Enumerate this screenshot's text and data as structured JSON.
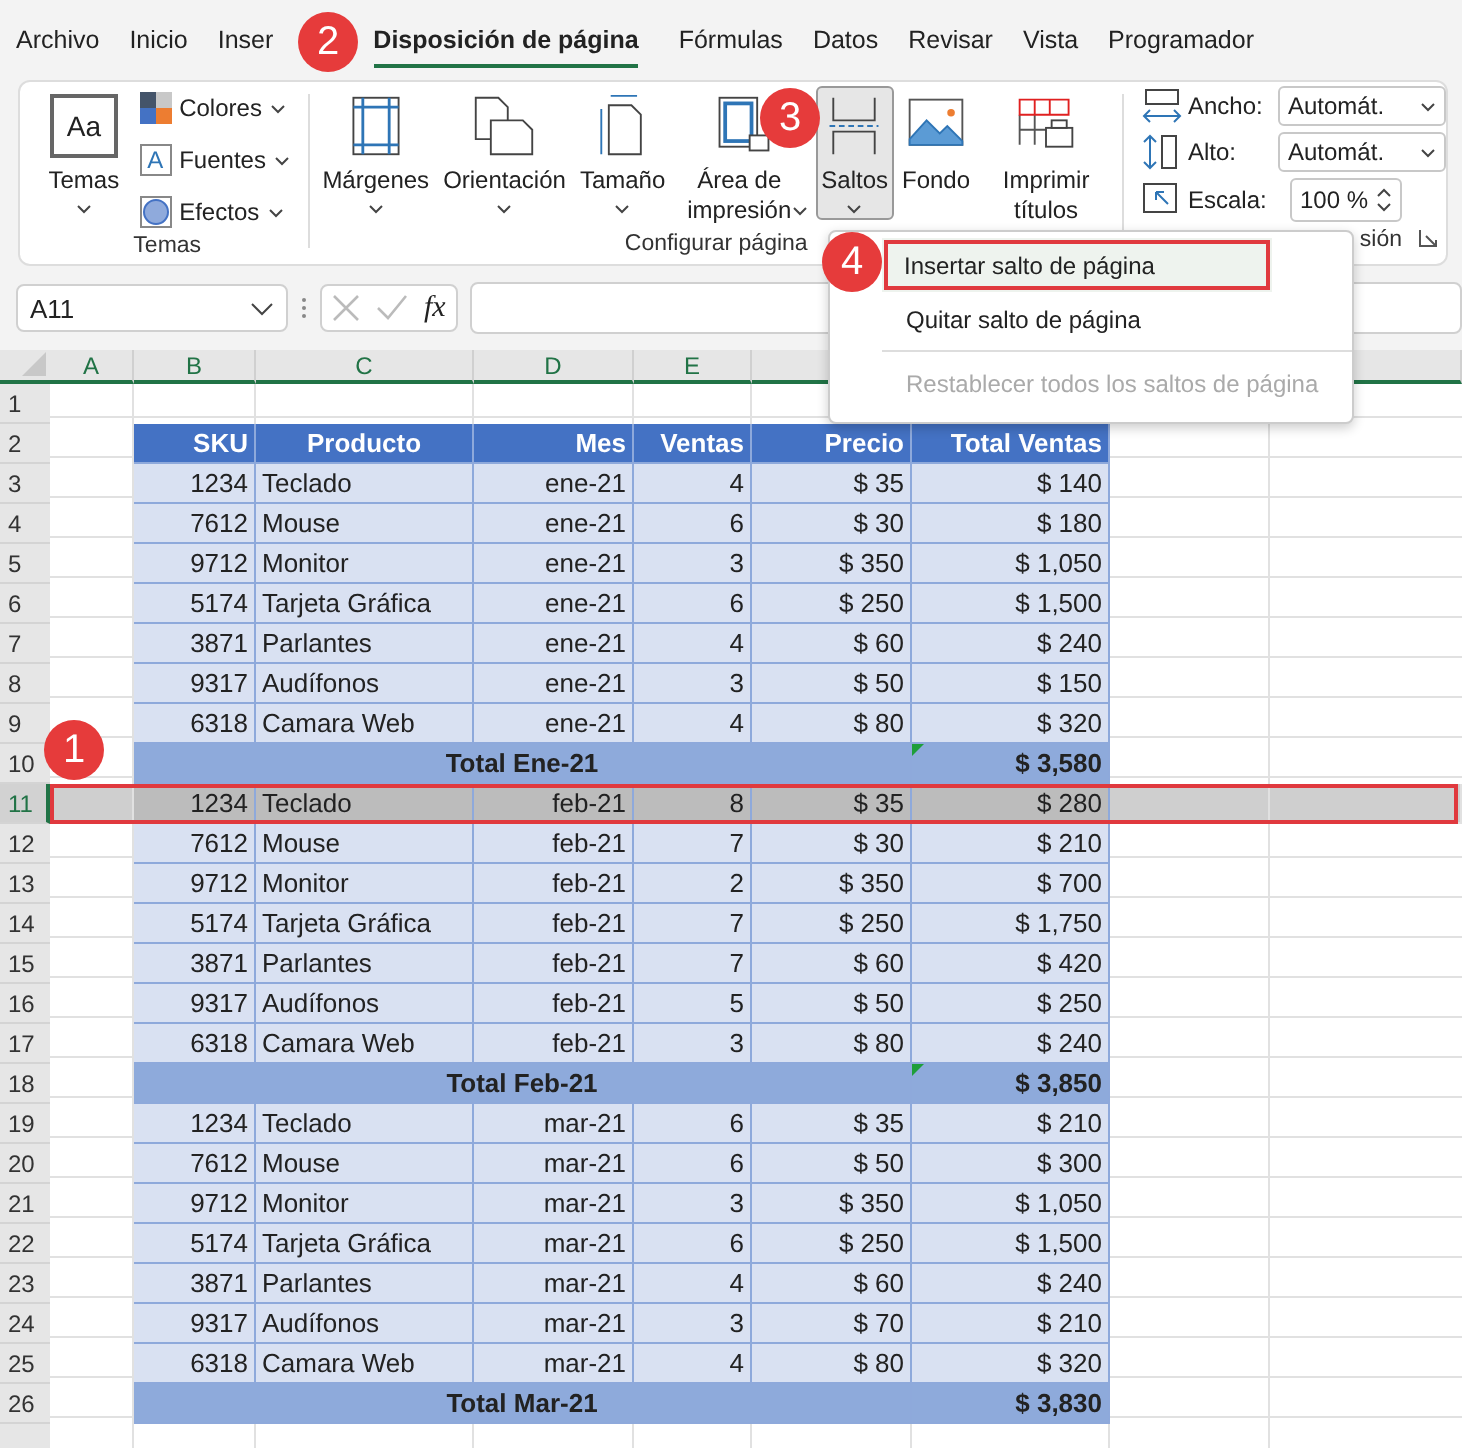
{
  "tabs": [
    {
      "label": "Archivo",
      "selected": false
    },
    {
      "label": "Inicio",
      "selected": false
    },
    {
      "label": "Inser",
      "selected": false
    },
    {
      "label": "Disposición de página",
      "selected": true
    },
    {
      "label": "Fórmulas",
      "selected": false
    },
    {
      "label": "Datos",
      "selected": false
    },
    {
      "label": "Revisar",
      "selected": false
    },
    {
      "label": "Vista",
      "selected": false
    },
    {
      "label": "Programador",
      "selected": false
    }
  ],
  "ribbon": {
    "themes_group": {
      "label": "Temas",
      "big_button": "Temas",
      "icon_text": "Aa",
      "font_icon_text": "A",
      "small_buttons": [
        "Colores",
        "Fuentes",
        "Efectos"
      ]
    },
    "page_setup_group": {
      "label": "Configurar página",
      "buttons": [
        {
          "kind": "margins",
          "label": "Márgenes",
          "pressed": false
        },
        {
          "kind": "orientation",
          "label": "Orientación",
          "pressed": false
        },
        {
          "kind": "size",
          "label": "Tamaño",
          "pressed": false
        },
        {
          "kind": "area",
          "label": "Área de impresión",
          "pressed": false
        },
        {
          "kind": "breaks",
          "label": "Saltos",
          "pressed": true
        },
        {
          "kind": "background",
          "label": "Fondo",
          "pressed": false
        },
        {
          "kind": "titles",
          "label": "Imprimir títulos",
          "pressed": false
        }
      ]
    },
    "scale_group": {
      "label": "sión",
      "width_label": "Ancho:",
      "width_value": "Automát.",
      "height_label": "Alto:",
      "height_value": "Automát.",
      "scale_label": "Escala:",
      "scale_value": "100 %"
    }
  },
  "breaks_menu": [
    {
      "label": "Insertar salto de página",
      "selected": true,
      "disabled": false
    },
    {
      "label": "Quitar salto de página",
      "selected": false,
      "disabled": false
    },
    {
      "label": "Restablecer todos los saltos de página",
      "selected": false,
      "disabled": true
    }
  ],
  "formula_bar": {
    "name_box": "A11",
    "fx": "fx"
  },
  "columns": [
    "A",
    "B",
    "C",
    "D",
    "E"
  ],
  "rows": [
    {
      "number": "1",
      "kind": "empty",
      "selected": false
    },
    {
      "number": "2",
      "kind": "header",
      "selected": false,
      "cells": [
        "SKU",
        "Producto",
        "Mes",
        "Ventas",
        "Precio",
        "Total Ventas"
      ]
    },
    {
      "number": "3",
      "kind": "data",
      "selected": false,
      "cells": [
        "1234",
        "Teclado",
        "ene-21",
        "4",
        "$ 35",
        "$ 140"
      ]
    },
    {
      "number": "4",
      "kind": "data",
      "selected": false,
      "cells": [
        "7612",
        "Mouse",
        "ene-21",
        "6",
        "$ 30",
        "$ 180"
      ]
    },
    {
      "number": "5",
      "kind": "data",
      "selected": false,
      "cells": [
        "9712",
        "Monitor",
        "ene-21",
        "3",
        "$ 350",
        "$ 1,050"
      ]
    },
    {
      "number": "6",
      "kind": "data",
      "selected": false,
      "cells": [
        "5174",
        "Tarjeta Gráfica",
        "ene-21",
        "6",
        "$ 250",
        "$ 1,500"
      ]
    },
    {
      "number": "7",
      "kind": "data",
      "selected": false,
      "cells": [
        "3871",
        "Parlantes",
        "ene-21",
        "4",
        "$ 60",
        "$ 240"
      ]
    },
    {
      "number": "8",
      "kind": "data",
      "selected": false,
      "cells": [
        "9317",
        "Audífonos",
        "ene-21",
        "3",
        "$ 50",
        "$ 150"
      ]
    },
    {
      "number": "9",
      "kind": "data",
      "selected": false,
      "cells": [
        "6318",
        "Camara Web",
        "ene-21",
        "4",
        "$ 80",
        "$ 320"
      ]
    },
    {
      "number": "10",
      "kind": "total",
      "selected": false,
      "flag": true,
      "cells": [
        "Total Ene-21",
        "$ 3,580"
      ]
    },
    {
      "number": "11",
      "kind": "data",
      "selected": true,
      "cells": [
        "1234",
        "Teclado",
        "feb-21",
        "8",
        "$ 35",
        "$ 280"
      ]
    },
    {
      "number": "12",
      "kind": "data",
      "selected": false,
      "cells": [
        "7612",
        "Mouse",
        "feb-21",
        "7",
        "$ 30",
        "$ 210"
      ]
    },
    {
      "number": "13",
      "kind": "data",
      "selected": false,
      "cells": [
        "9712",
        "Monitor",
        "feb-21",
        "2",
        "$ 350",
        "$ 700"
      ]
    },
    {
      "number": "14",
      "kind": "data",
      "selected": false,
      "cells": [
        "5174",
        "Tarjeta Gráfica",
        "feb-21",
        "7",
        "$ 250",
        "$ 1,750"
      ]
    },
    {
      "number": "15",
      "kind": "data",
      "selected": false,
      "cells": [
        "3871",
        "Parlantes",
        "feb-21",
        "7",
        "$ 60",
        "$ 420"
      ]
    },
    {
      "number": "16",
      "kind": "data",
      "selected": false,
      "cells": [
        "9317",
        "Audífonos",
        "feb-21",
        "5",
        "$ 50",
        "$ 250"
      ]
    },
    {
      "number": "17",
      "kind": "data",
      "selected": false,
      "cells": [
        "6318",
        "Camara Web",
        "feb-21",
        "3",
        "$ 80",
        "$ 240"
      ]
    },
    {
      "number": "18",
      "kind": "total",
      "selected": false,
      "flag": true,
      "cells": [
        "Total Feb-21",
        "$ 3,850"
      ]
    },
    {
      "number": "19",
      "kind": "data",
      "selected": false,
      "cells": [
        "1234",
        "Teclado",
        "mar-21",
        "6",
        "$ 35",
        "$ 210"
      ]
    },
    {
      "number": "20",
      "kind": "data",
      "selected": false,
      "cells": [
        "7612",
        "Mouse",
        "mar-21",
        "6",
        "$ 50",
        "$ 300"
      ]
    },
    {
      "number": "21",
      "kind": "data",
      "selected": false,
      "cells": [
        "9712",
        "Monitor",
        "mar-21",
        "3",
        "$ 350",
        "$ 1,050"
      ]
    },
    {
      "number": "22",
      "kind": "data",
      "selected": false,
      "cells": [
        "5174",
        "Tarjeta Gráfica",
        "mar-21",
        "6",
        "$ 250",
        "$ 1,500"
      ]
    },
    {
      "number": "23",
      "kind": "data",
      "selected": false,
      "cells": [
        "3871",
        "Parlantes",
        "mar-21",
        "4",
        "$ 60",
        "$ 240"
      ]
    },
    {
      "number": "24",
      "kind": "data",
      "selected": false,
      "cells": [
        "9317",
        "Audífonos",
        "mar-21",
        "3",
        "$ 70",
        "$ 210"
      ]
    },
    {
      "number": "25",
      "kind": "data",
      "selected": false,
      "cells": [
        "6318",
        "Camara Web",
        "mar-21",
        "4",
        "$ 80",
        "$ 320"
      ]
    },
    {
      "number": "26",
      "kind": "total",
      "selected": false,
      "flag": false,
      "cells": [
        "Total Mar-21",
        "$ 3,830"
      ]
    }
  ],
  "callouts": [
    "1",
    "2",
    "3",
    "4"
  ]
}
